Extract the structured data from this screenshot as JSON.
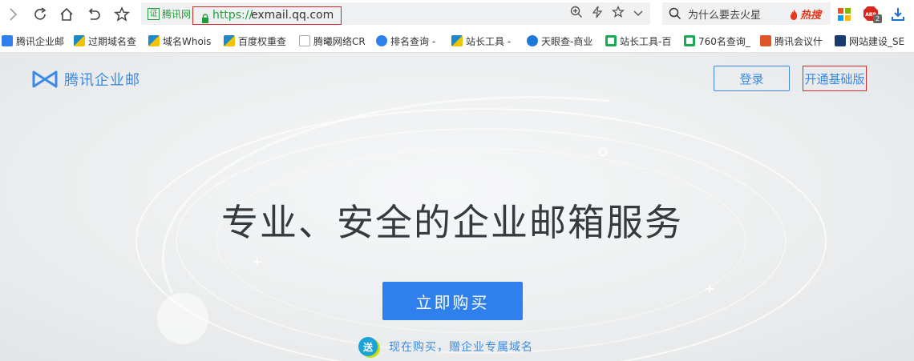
{
  "browser": {
    "cert_label": "腾讯网",
    "cert_icon_text": "证",
    "url_scheme": "https://",
    "url_host": "exmail.qq.com",
    "search_placeholder": "为什么要去火星",
    "hot_search_label": "热搜",
    "extension_badge": "2"
  },
  "bookmarks": [
    {
      "label": "腾讯企业邮",
      "icon": "tencent-exmail-icon",
      "color": "#2f80ed"
    },
    {
      "label": "过期域名查",
      "icon": "chinaz-icon",
      "color": "#1e88c8"
    },
    {
      "label": "域名Whois",
      "icon": "chinaz-icon",
      "color": "#1e88c8"
    },
    {
      "label": "百度权重查",
      "icon": "chinaz-icon",
      "color": "#1e88c8"
    },
    {
      "label": "腾曦网络CR",
      "icon": "page-icon",
      "color": "#cccccc"
    },
    {
      "label": "排名查询 -",
      "icon": "ranking-icon",
      "color": "#2f80ed"
    },
    {
      "label": "站长工具 -",
      "icon": "chinaz-icon",
      "color": "#1e88c8"
    },
    {
      "label": "天眼查-商业",
      "icon": "tianyancha-icon",
      "color": "#1e78d8"
    },
    {
      "label": "站长工具-百",
      "icon": "aizhan-icon",
      "color": "#1aaa55"
    },
    {
      "label": "760名查询_",
      "icon": "aizhan-icon",
      "color": "#1aaa55"
    },
    {
      "label": "腾讯会议什",
      "icon": "b-icon",
      "color": "#e0542a"
    },
    {
      "label": "网站建设_SE",
      "icon": "site-icon",
      "color": "#1a3a6e"
    }
  ],
  "page": {
    "logo_text": "腾讯企业邮",
    "login_label": "登录",
    "basic_label": "开通基础版",
    "hero_title": "专业、安全的企业邮箱服务",
    "buy_label": "立即购买",
    "promo_badge": "送",
    "promo_text": "现在购买，赠企业专属域名"
  },
  "colors": {
    "brand_blue": "#2f80ed",
    "link_blue": "#3b8be6",
    "secure_green": "#1f9d3a",
    "highlight_red": "#d22a2a"
  }
}
